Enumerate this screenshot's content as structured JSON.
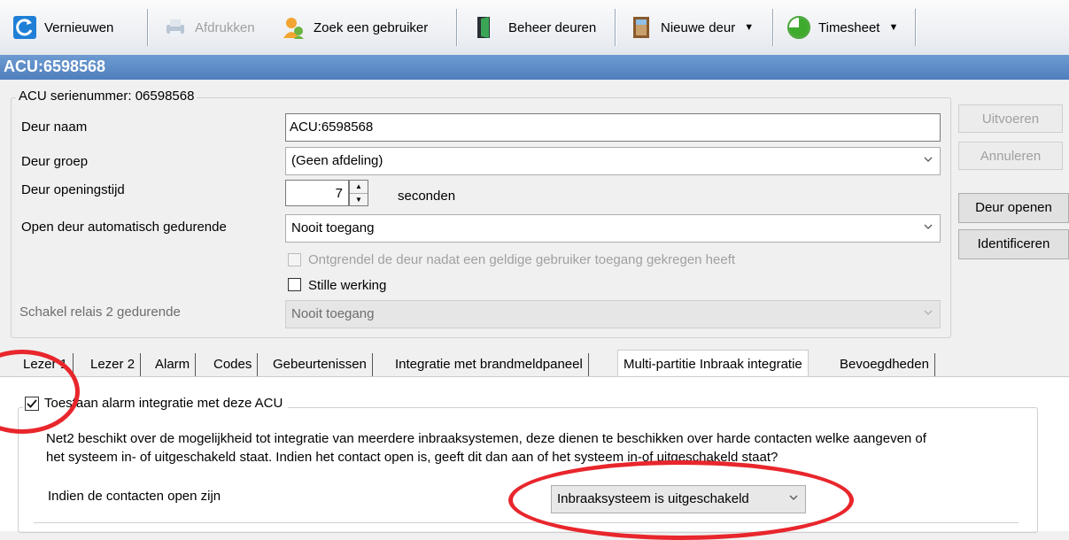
{
  "toolbar": {
    "refresh": "Vernieuwen",
    "print": "Afdrukken",
    "find_user": "Zoek een gebruiker",
    "manage_doors": "Beheer deuren",
    "new_door": "Nieuwe deur",
    "timesheet": "Timesheet"
  },
  "title": "ACU:6598568",
  "group": {
    "legend": "ACU serienummer: 06598568",
    "door_name_label": "Deur naam",
    "door_name_value": "ACU:6598568",
    "door_group_label": "Deur groep",
    "door_group_value": "(Geen afdeling)",
    "open_time_label": "Deur openingstijd",
    "open_time_value": "7",
    "open_time_unit": "seconden",
    "auto_open_label": "Open deur automatisch gedurende",
    "auto_open_value": "Nooit toegang",
    "unlock_after_label": "Ontgrendel de deur nadat een geldige gebruiker toegang gekregen heeft",
    "silent_label": "Stille werking",
    "relay2_label": "Schakel relais 2 gedurende",
    "relay2_value": "Nooit toegang"
  },
  "buttons": {
    "execute": "Uitvoeren",
    "cancel": "Annuleren",
    "open_door": "Deur openen",
    "identify": "Identificeren"
  },
  "tabs": [
    "Lezer 1",
    "Lezer 2",
    "Alarm",
    "Codes",
    "Gebeurtenissen",
    "Integratie met brandmeldpaneel",
    "Multi-partitie Inbraak integratie",
    "Bevoegdheden"
  ],
  "panel": {
    "allow_label": "Toestaan alarm integratie met deze ACU",
    "description_line1": "Net2 beschikt over de mogelijkheid tot integratie van meerdere inbraaksystemen, deze dienen te beschikken over harde contacten welke aangeven of",
    "description_line2": "het systeem in- of uitgeschakeld staat. Indien het contact open is, geeft dit dan aan of het systeem in-of uitgeschakeld staat?",
    "contacts_label": "Indien de contacten open zijn",
    "contacts_value": "Inbraaksysteem is uitgeschakeld"
  },
  "colors": {
    "titlebar": "#5a8ac8",
    "highlight": "#e8262c"
  }
}
